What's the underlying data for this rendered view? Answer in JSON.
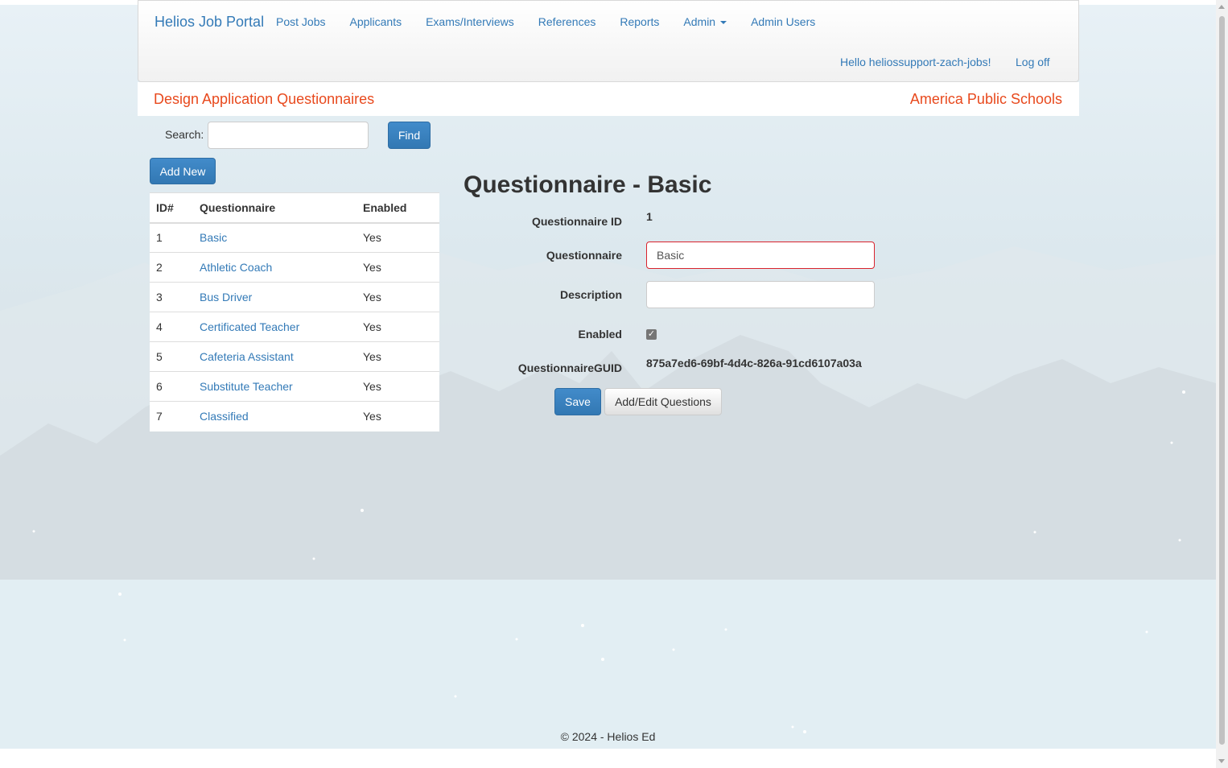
{
  "nav": {
    "brand": "Helios Job Portal",
    "links": [
      "Post Jobs",
      "Applicants",
      "Exams/Interviews",
      "References",
      "Reports",
      "Admin",
      "Admin Users"
    ],
    "hello": "Hello heliossupport-zach-jobs!",
    "logoff": "Log off"
  },
  "subheader": {
    "title": "Design Application Questionnaires",
    "org": "America Public Schools"
  },
  "search": {
    "label": "Search:",
    "value": "",
    "find_label": "Find"
  },
  "add_new_label": "Add New",
  "table": {
    "headers": [
      "ID#",
      "Questionnaire",
      "Enabled"
    ],
    "rows": [
      {
        "id": "1",
        "name": "Basic",
        "enabled": "Yes"
      },
      {
        "id": "2",
        "name": "Athletic Coach",
        "enabled": "Yes"
      },
      {
        "id": "3",
        "name": "Bus Driver",
        "enabled": "Yes"
      },
      {
        "id": "4",
        "name": "Certificated Teacher",
        "enabled": "Yes"
      },
      {
        "id": "5",
        "name": "Cafeteria Assistant",
        "enabled": "Yes"
      },
      {
        "id": "6",
        "name": "Substitute Teacher",
        "enabled": "Yes"
      },
      {
        "id": "7",
        "name": "Classified",
        "enabled": "Yes"
      }
    ]
  },
  "detail": {
    "title": "Questionnaire - Basic",
    "id_label": "Questionnaire ID",
    "id_value": "1",
    "name_label": "Questionnaire",
    "name_value": "Basic",
    "desc_label": "Description",
    "desc_value": "",
    "enabled_label": "Enabled",
    "enabled_checked": true,
    "guid_label": "QuestionnaireGUID",
    "guid_value": "875a7ed6-69bf-4d4c-826a-91cd6107a03a",
    "save_label": "Save",
    "edit_questions_label": "Add/Edit Questions"
  },
  "footer": "© 2024 - Helios Ed",
  "colors": {
    "link": "#337ab7",
    "accent_orange": "#e8491d",
    "primary_button": "#3278b3",
    "error_border": "#d9232d"
  }
}
